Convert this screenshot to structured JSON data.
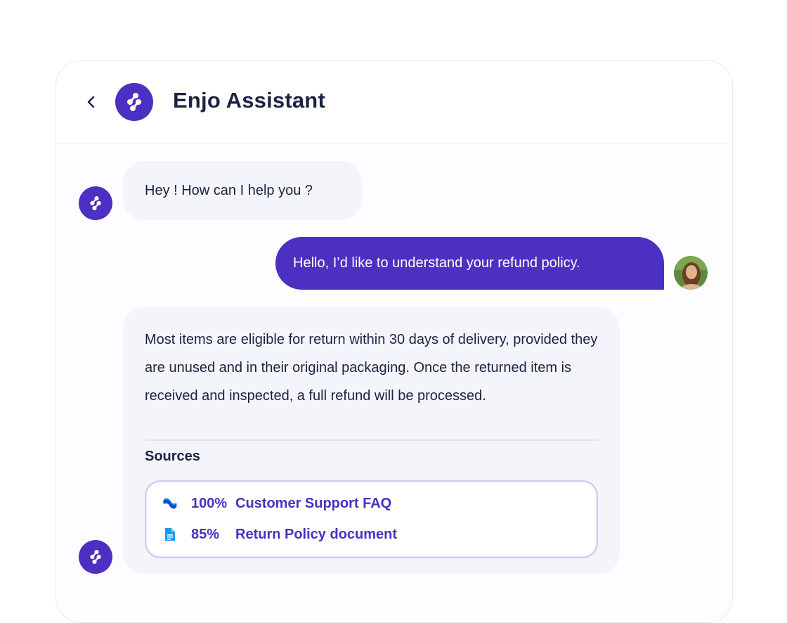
{
  "header": {
    "title": "Enjo Assistant",
    "back_icon": "chevron-left-icon",
    "logo_icon": "enjo-logo-icon"
  },
  "messages": [
    {
      "sender": "bot",
      "text": "Hey ! How can I help you ?"
    },
    {
      "sender": "user",
      "text": "Hello, I’d like to understand your refund policy."
    },
    {
      "sender": "bot",
      "text": "Most items are eligible for return within 30 days of delivery, provided they are unused and in their original packaging. Once the returned item is received and inspected, a full refund will be processed.",
      "sources_label": "Sources",
      "sources": [
        {
          "percent": "100%",
          "title": "Customer Support FAQ",
          "icon": "confluence-icon"
        },
        {
          "percent": "85%",
          "title": "Return Policy document",
          "icon": "document-icon"
        }
      ]
    }
  ],
  "colors": {
    "accent": "#4b30c2",
    "text": "#1c2340",
    "bot_bubble": "#f4f4fb",
    "user_bubble": "#4b30c2",
    "source_border": "#d9c6f0"
  }
}
